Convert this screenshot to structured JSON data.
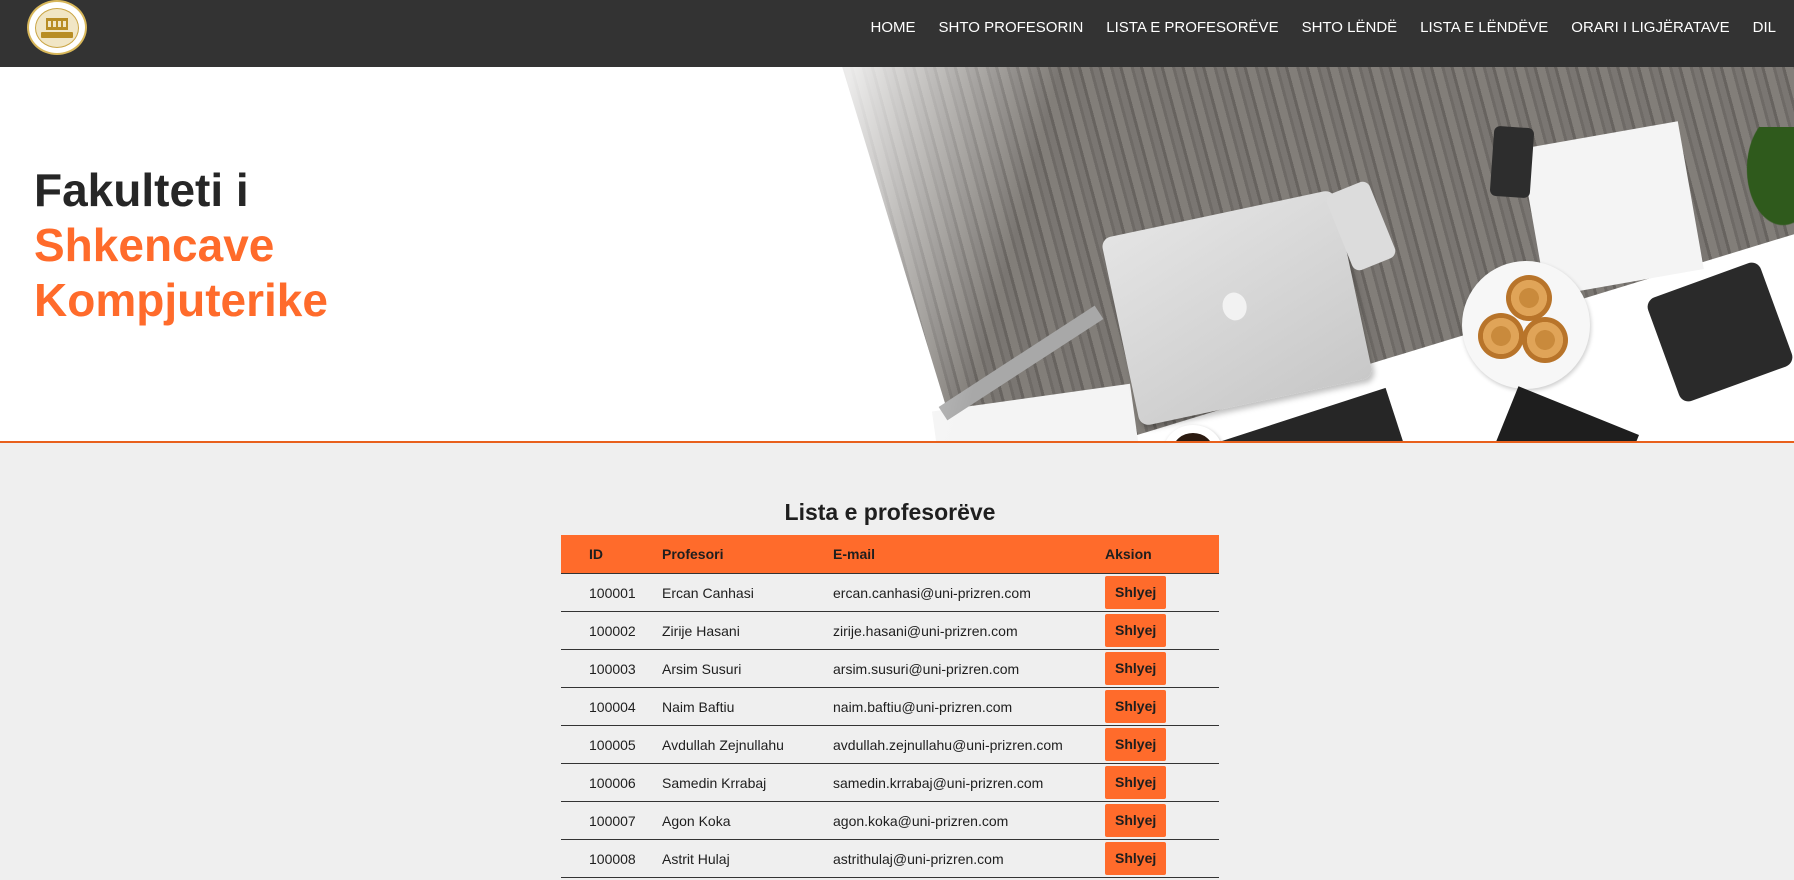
{
  "nav": {
    "items": [
      {
        "label": "HOME"
      },
      {
        "label": "SHTO PROFESORIN"
      },
      {
        "label": "LISTA E PROFESORËVE"
      },
      {
        "label": "SHTO LËNDË"
      },
      {
        "label": "LISTA E LËNDËVE"
      },
      {
        "label": "ORARI I LIGJËRATAVE"
      },
      {
        "label": "DIL"
      }
    ]
  },
  "logo": {
    "icon": "university-seal-icon"
  },
  "hero": {
    "line1": "Fakulteti i",
    "line2": "Shkencave",
    "line3": "Kompjuterike"
  },
  "section": {
    "title": "Lista e profesorëve"
  },
  "table": {
    "headers": {
      "id": "ID",
      "name": "Profesori",
      "email": "E-mail",
      "action": "Aksion"
    },
    "rows": [
      {
        "id": "100001",
        "name": "Ercan Canhasi",
        "email": "ercan.canhasi@uni-prizren.com",
        "action": "Shlyej"
      },
      {
        "id": "100002",
        "name": "Zirije Hasani",
        "email": "zirije.hasani@uni-prizren.com",
        "action": "Shlyej"
      },
      {
        "id": "100003",
        "name": "Arsim Susuri",
        "email": "arsim.susuri@uni-prizren.com",
        "action": "Shlyej"
      },
      {
        "id": "100004",
        "name": "Naim Baftiu",
        "email": "naim.baftiu@uni-prizren.com",
        "action": "Shlyej"
      },
      {
        "id": "100005",
        "name": "Avdullah Zejnullahu",
        "email": "avdullah.zejnullahu@uni-prizren.com",
        "action": "Shlyej"
      },
      {
        "id": "100006",
        "name": "Samedin Krrabaj",
        "email": "samedin.krrabaj@uni-prizren.com",
        "action": "Shlyej"
      },
      {
        "id": "100007",
        "name": "Agon Koka",
        "email": "agon.koka@uni-prizren.com",
        "action": "Shlyej"
      },
      {
        "id": "100008",
        "name": "Astrit Hulaj",
        "email": "astrithulaj@uni-prizren.com",
        "action": "Shlyej"
      }
    ]
  },
  "colors": {
    "accent": "#ff6b2b",
    "navbar": "#333333",
    "background": "#efefef"
  }
}
